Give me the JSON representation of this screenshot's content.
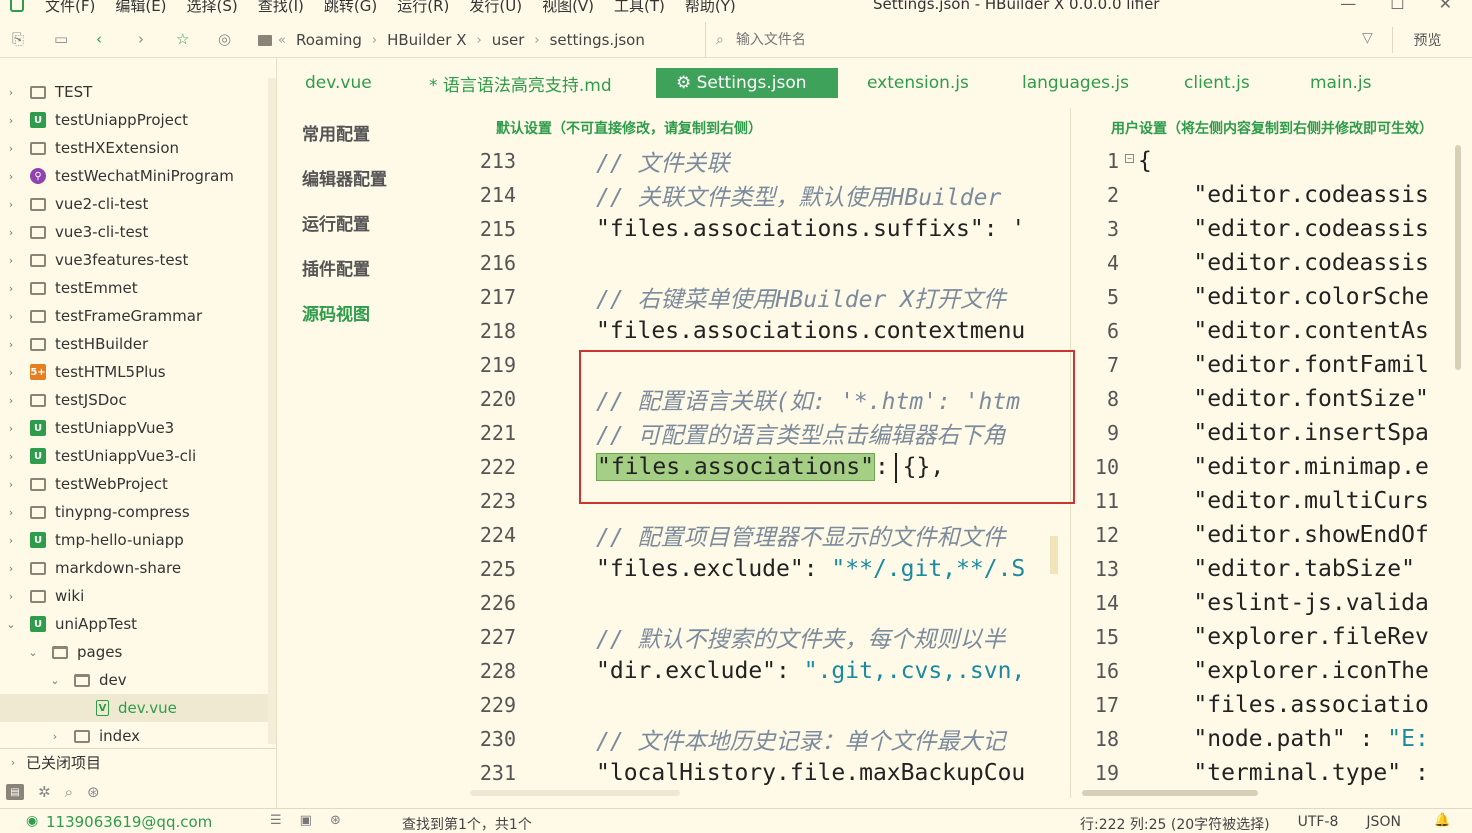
{
  "menu": [
    "文件(F)",
    "编辑(E)",
    "选择(S)",
    "查找(I)",
    "跳转(G)",
    "运行(R)",
    "发行(U)",
    "视图(V)",
    "工具(T)",
    "帮助(Y)"
  ],
  "window_title": "Settings.json - HBuilder X 0.0.0.0 lifier",
  "breadcrumb": [
    "Roaming",
    "HBuilder X",
    "user",
    "settings.json"
  ],
  "search_placeholder": "输入文件名",
  "preview_label": "预览",
  "tree": [
    {
      "label": "TEST",
      "icon": "folder",
      "chev": "›",
      "indent": 0
    },
    {
      "label": "testUniappProject",
      "icon": "uni",
      "chev": "›",
      "indent": 0
    },
    {
      "label": "testHXExtension",
      "icon": "folder",
      "chev": "›",
      "indent": 0
    },
    {
      "label": "testWechatMiniProgram",
      "icon": "wx",
      "chev": "›",
      "indent": 0
    },
    {
      "label": "vue2-cli-test",
      "icon": "folder",
      "chev": "›",
      "indent": 0
    },
    {
      "label": "vue3-cli-test",
      "icon": "folder",
      "chev": "›",
      "indent": 0
    },
    {
      "label": "vue3features-test",
      "icon": "folder",
      "chev": "›",
      "indent": 0
    },
    {
      "label": "testEmmet",
      "icon": "folder",
      "chev": "›",
      "indent": 0
    },
    {
      "label": "testFrameGrammar",
      "icon": "folder",
      "chev": "›",
      "indent": 0
    },
    {
      "label": "testHBuilder",
      "icon": "folder",
      "chev": "›",
      "indent": 0
    },
    {
      "label": "testHTML5Plus",
      "icon": "h5",
      "chev": "›",
      "indent": 0
    },
    {
      "label": "testJSDoc",
      "icon": "folder",
      "chev": "›",
      "indent": 0
    },
    {
      "label": "testUniappVue3",
      "icon": "uni",
      "chev": "›",
      "indent": 0
    },
    {
      "label": "testUniappVue3-cli",
      "icon": "uni",
      "chev": "›",
      "indent": 0
    },
    {
      "label": "testWebProject",
      "icon": "folder",
      "chev": "›",
      "indent": 0
    },
    {
      "label": "tinypng-compress",
      "icon": "folder",
      "chev": "›",
      "indent": 0
    },
    {
      "label": "tmp-hello-uniapp",
      "icon": "uni",
      "chev": "›",
      "indent": 0
    },
    {
      "label": "markdown-share",
      "icon": "folder",
      "chev": "›",
      "indent": 0
    },
    {
      "label": "wiki",
      "icon": "folder",
      "chev": "›",
      "indent": 0
    },
    {
      "label": "uniAppTest",
      "icon": "uni",
      "chev": "⌄",
      "indent": 0
    },
    {
      "label": "pages",
      "icon": "folder-open",
      "chev": "⌄",
      "indent": 1
    },
    {
      "label": "dev",
      "icon": "folder-open",
      "chev": "⌄",
      "indent": 2
    },
    {
      "label": "dev.vue",
      "icon": "file",
      "chev": "",
      "indent": 3,
      "selected": true
    },
    {
      "label": "index",
      "icon": "folder",
      "chev": "›",
      "indent": 2
    }
  ],
  "closed_projects": "已关闭项目",
  "tabs": [
    "dev.vue",
    "* 语言语法高亮支持.md",
    "⚙ Settings.json",
    "extension.js",
    "languages.js",
    "client.js",
    "main.js"
  ],
  "nav": [
    "常用配置",
    "编辑器配置",
    "运行配置",
    "插件配置",
    "源码视图"
  ],
  "left_pane_title": "默认设置（不可直接修改，请复制到右侧）",
  "right_pane_title": "用户设置（将左侧内容复制到右侧并修改即可生效）",
  "left_lines": [
    {
      "n": "213",
      "c": "// 文件关联",
      "type": "comment"
    },
    {
      "n": "214",
      "c": "// 关联文件类型，默认使用HBuilder",
      "type": "comment"
    },
    {
      "n": "215",
      "c": "\"files.associations.suffixs\": '",
      "type": "code"
    },
    {
      "n": "216",
      "c": "",
      "type": "code"
    },
    {
      "n": "217",
      "c": "// 右键菜单使用HBuilder X打开文件",
      "type": "comment"
    },
    {
      "n": "218",
      "c": "\"files.associations.contextmenu",
      "type": "code"
    },
    {
      "n": "219",
      "c": "",
      "type": "code"
    },
    {
      "n": "220",
      "c": "// 配置语言关联(如: '*.htm': 'htm",
      "type": "comment"
    },
    {
      "n": "221",
      "c": "// 可配置的语言类型点击编辑器右下角",
      "type": "comment"
    },
    {
      "n": "222",
      "c": "\"files.associations\": {},",
      "type": "highlight"
    },
    {
      "n": "223",
      "c": "",
      "type": "code"
    },
    {
      "n": "224",
      "c": "// 配置项目管理器不显示的文件和文件",
      "type": "comment"
    },
    {
      "n": "225",
      "c": "\"files.exclude\": \"**/.git,**/.S",
      "type": "kv"
    },
    {
      "n": "226",
      "c": "",
      "type": "code"
    },
    {
      "n": "227",
      "c": "// 默认不搜索的文件夹，每个规则以半",
      "type": "comment"
    },
    {
      "n": "228",
      "c": "\"dir.exclude\": \".git,.cvs,.svn,",
      "type": "kv"
    },
    {
      "n": "229",
      "c": "",
      "type": "code"
    },
    {
      "n": "230",
      "c": "// 文件本地历史记录：单个文件最大记",
      "type": "comment"
    },
    {
      "n": "231",
      "c": "\"localHistory.file.maxBackupCou",
      "type": "code"
    }
  ],
  "right_lines": [
    {
      "n": "1",
      "c": "{"
    },
    {
      "n": "2",
      "c": "    \"editor.codeassis"
    },
    {
      "n": "3",
      "c": "    \"editor.codeassis"
    },
    {
      "n": "4",
      "c": "    \"editor.codeassis"
    },
    {
      "n": "5",
      "c": "    \"editor.colorSche"
    },
    {
      "n": "6",
      "c": "    \"editor.contentAs"
    },
    {
      "n": "7",
      "c": "    \"editor.fontFamil"
    },
    {
      "n": "8",
      "c": "    \"editor.fontSize\""
    },
    {
      "n": "9",
      "c": "    \"editor.insertSpa"
    },
    {
      "n": "10",
      "c": "    \"editor.minimap.e"
    },
    {
      "n": "11",
      "c": "    \"editor.multiCurs"
    },
    {
      "n": "12",
      "c": "    \"editor.showEndOf"
    },
    {
      "n": "13",
      "c": "    \"editor.tabSize\""
    },
    {
      "n": "14",
      "c": "    \"eslint-js.valida"
    },
    {
      "n": "15",
      "c": "    \"explorer.fileRev"
    },
    {
      "n": "16",
      "c": "    \"explorer.iconThe"
    },
    {
      "n": "17",
      "c": "    \"files.associatio"
    },
    {
      "n": "18",
      "c": "    \"node.path\" : \"E:"
    },
    {
      "n": "19",
      "c": "    \"terminal.type\" :"
    }
  ],
  "status": {
    "user": "1139063619@qq.com",
    "find": "查找到第1个，共1个",
    "position": "行:222  列:25 (20字符被选择)",
    "encoding": "UTF-8",
    "lang": "JSON"
  }
}
